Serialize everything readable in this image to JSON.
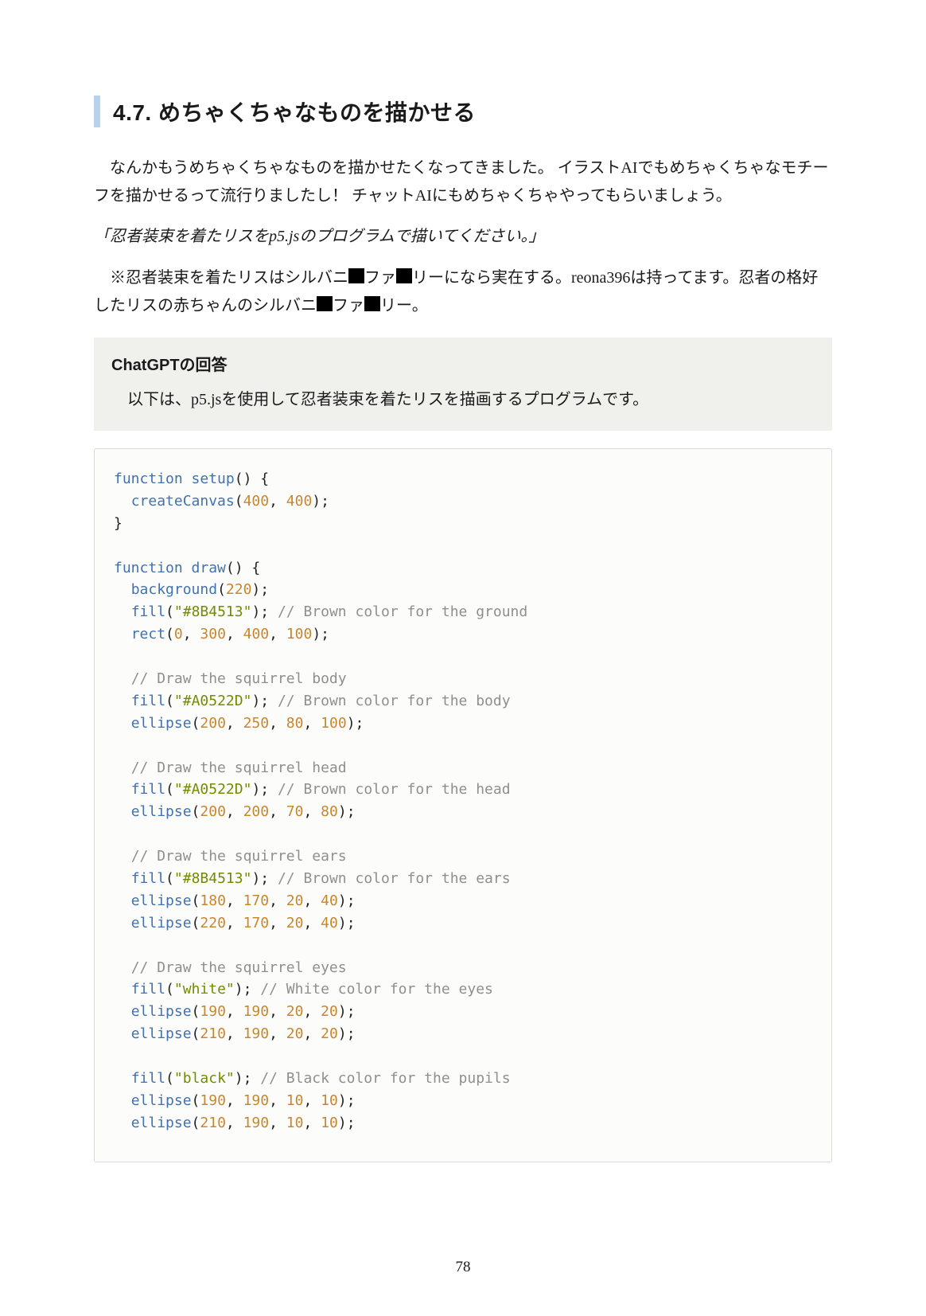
{
  "heading": "4.7. めちゃくちゃなものを描かせる",
  "para1": "なんかもうめちゃくちゃなものを描かせたくなってきました。 イラストAIでもめちゃくちゃなモチーフを描かせるって流行りましたし！ チャットAIにもめちゃくちゃやってもらいましょう。",
  "quote": "「忍者装束を着たリスをp5.jsのプログラムで描いてください。」",
  "note_pre": "※忍者装束を着たリスはシルバニ",
  "note_mid1": "ファ",
  "note_mid2": "リーになら実在する。reona396は持ってます。忍者の格好したリスの赤ちゃんのシルバニ",
  "note_mid3": "ファ",
  "note_end": "リー。",
  "response_title": "ChatGPTの回答",
  "response_text": "以下は、p5.jsを使用して忍者装束を着たリスを描画するプログラムです。",
  "code_tokens": [
    [
      [
        "kw",
        "function"
      ],
      [
        "pl",
        " "
      ],
      [
        "fn",
        "setup"
      ],
      [
        "pl",
        "() {"
      ]
    ],
    [
      [
        "pl",
        "  "
      ],
      [
        "fn",
        "createCanvas"
      ],
      [
        "pl",
        "("
      ],
      [
        "num",
        "400"
      ],
      [
        "pl",
        ", "
      ],
      [
        "num",
        "400"
      ],
      [
        "pl",
        ");"
      ]
    ],
    [
      [
        "pl",
        "}"
      ]
    ],
    [],
    [
      [
        "kw",
        "function"
      ],
      [
        "pl",
        " "
      ],
      [
        "fn",
        "draw"
      ],
      [
        "pl",
        "() {"
      ]
    ],
    [
      [
        "pl",
        "  "
      ],
      [
        "fn",
        "background"
      ],
      [
        "pl",
        "("
      ],
      [
        "num",
        "220"
      ],
      [
        "pl",
        ");"
      ]
    ],
    [
      [
        "pl",
        "  "
      ],
      [
        "fn",
        "fill"
      ],
      [
        "pl",
        "("
      ],
      [
        "str",
        "\"#8B4513\""
      ],
      [
        "pl",
        "); "
      ],
      [
        "cmt",
        "// Brown color for the ground"
      ]
    ],
    [
      [
        "pl",
        "  "
      ],
      [
        "fn",
        "rect"
      ],
      [
        "pl",
        "("
      ],
      [
        "num",
        "0"
      ],
      [
        "pl",
        ", "
      ],
      [
        "num",
        "300"
      ],
      [
        "pl",
        ", "
      ],
      [
        "num",
        "400"
      ],
      [
        "pl",
        ", "
      ],
      [
        "num",
        "100"
      ],
      [
        "pl",
        ");"
      ]
    ],
    [],
    [
      [
        "pl",
        "  "
      ],
      [
        "cmt",
        "// Draw the squirrel body"
      ]
    ],
    [
      [
        "pl",
        "  "
      ],
      [
        "fn",
        "fill"
      ],
      [
        "pl",
        "("
      ],
      [
        "str",
        "\"#A0522D\""
      ],
      [
        "pl",
        "); "
      ],
      [
        "cmt",
        "// Brown color for the body"
      ]
    ],
    [
      [
        "pl",
        "  "
      ],
      [
        "fn",
        "ellipse"
      ],
      [
        "pl",
        "("
      ],
      [
        "num",
        "200"
      ],
      [
        "pl",
        ", "
      ],
      [
        "num",
        "250"
      ],
      [
        "pl",
        ", "
      ],
      [
        "num",
        "80"
      ],
      [
        "pl",
        ", "
      ],
      [
        "num",
        "100"
      ],
      [
        "pl",
        ");"
      ]
    ],
    [],
    [
      [
        "pl",
        "  "
      ],
      [
        "cmt",
        "// Draw the squirrel head"
      ]
    ],
    [
      [
        "pl",
        "  "
      ],
      [
        "fn",
        "fill"
      ],
      [
        "pl",
        "("
      ],
      [
        "str",
        "\"#A0522D\""
      ],
      [
        "pl",
        "); "
      ],
      [
        "cmt",
        "// Brown color for the head"
      ]
    ],
    [
      [
        "pl",
        "  "
      ],
      [
        "fn",
        "ellipse"
      ],
      [
        "pl",
        "("
      ],
      [
        "num",
        "200"
      ],
      [
        "pl",
        ", "
      ],
      [
        "num",
        "200"
      ],
      [
        "pl",
        ", "
      ],
      [
        "num",
        "70"
      ],
      [
        "pl",
        ", "
      ],
      [
        "num",
        "80"
      ],
      [
        "pl",
        ");"
      ]
    ],
    [],
    [
      [
        "pl",
        "  "
      ],
      [
        "cmt",
        "// Draw the squirrel ears"
      ]
    ],
    [
      [
        "pl",
        "  "
      ],
      [
        "fn",
        "fill"
      ],
      [
        "pl",
        "("
      ],
      [
        "str",
        "\"#8B4513\""
      ],
      [
        "pl",
        "); "
      ],
      [
        "cmt",
        "// Brown color for the ears"
      ]
    ],
    [
      [
        "pl",
        "  "
      ],
      [
        "fn",
        "ellipse"
      ],
      [
        "pl",
        "("
      ],
      [
        "num",
        "180"
      ],
      [
        "pl",
        ", "
      ],
      [
        "num",
        "170"
      ],
      [
        "pl",
        ", "
      ],
      [
        "num",
        "20"
      ],
      [
        "pl",
        ", "
      ],
      [
        "num",
        "40"
      ],
      [
        "pl",
        ");"
      ]
    ],
    [
      [
        "pl",
        "  "
      ],
      [
        "fn",
        "ellipse"
      ],
      [
        "pl",
        "("
      ],
      [
        "num",
        "220"
      ],
      [
        "pl",
        ", "
      ],
      [
        "num",
        "170"
      ],
      [
        "pl",
        ", "
      ],
      [
        "num",
        "20"
      ],
      [
        "pl",
        ", "
      ],
      [
        "num",
        "40"
      ],
      [
        "pl",
        ");"
      ]
    ],
    [],
    [
      [
        "pl",
        "  "
      ],
      [
        "cmt",
        "// Draw the squirrel eyes"
      ]
    ],
    [
      [
        "pl",
        "  "
      ],
      [
        "fn",
        "fill"
      ],
      [
        "pl",
        "("
      ],
      [
        "str",
        "\"white\""
      ],
      [
        "pl",
        "); "
      ],
      [
        "cmt",
        "// White color for the eyes"
      ]
    ],
    [
      [
        "pl",
        "  "
      ],
      [
        "fn",
        "ellipse"
      ],
      [
        "pl",
        "("
      ],
      [
        "num",
        "190"
      ],
      [
        "pl",
        ", "
      ],
      [
        "num",
        "190"
      ],
      [
        "pl",
        ", "
      ],
      [
        "num",
        "20"
      ],
      [
        "pl",
        ", "
      ],
      [
        "num",
        "20"
      ],
      [
        "pl",
        ");"
      ]
    ],
    [
      [
        "pl",
        "  "
      ],
      [
        "fn",
        "ellipse"
      ],
      [
        "pl",
        "("
      ],
      [
        "num",
        "210"
      ],
      [
        "pl",
        ", "
      ],
      [
        "num",
        "190"
      ],
      [
        "pl",
        ", "
      ],
      [
        "num",
        "20"
      ],
      [
        "pl",
        ", "
      ],
      [
        "num",
        "20"
      ],
      [
        "pl",
        ");"
      ]
    ],
    [],
    [
      [
        "pl",
        "  "
      ],
      [
        "fn",
        "fill"
      ],
      [
        "pl",
        "("
      ],
      [
        "str",
        "\"black\""
      ],
      [
        "pl",
        "); "
      ],
      [
        "cmt",
        "// Black color for the pupils"
      ]
    ],
    [
      [
        "pl",
        "  "
      ],
      [
        "fn",
        "ellipse"
      ],
      [
        "pl",
        "("
      ],
      [
        "num",
        "190"
      ],
      [
        "pl",
        ", "
      ],
      [
        "num",
        "190"
      ],
      [
        "pl",
        ", "
      ],
      [
        "num",
        "10"
      ],
      [
        "pl",
        ", "
      ],
      [
        "num",
        "10"
      ],
      [
        "pl",
        ");"
      ]
    ],
    [
      [
        "pl",
        "  "
      ],
      [
        "fn",
        "ellipse"
      ],
      [
        "pl",
        "("
      ],
      [
        "num",
        "210"
      ],
      [
        "pl",
        ", "
      ],
      [
        "num",
        "190"
      ],
      [
        "pl",
        ", "
      ],
      [
        "num",
        "10"
      ],
      [
        "pl",
        ", "
      ],
      [
        "num",
        "10"
      ],
      [
        "pl",
        ");"
      ]
    ]
  ],
  "page_number": "78"
}
